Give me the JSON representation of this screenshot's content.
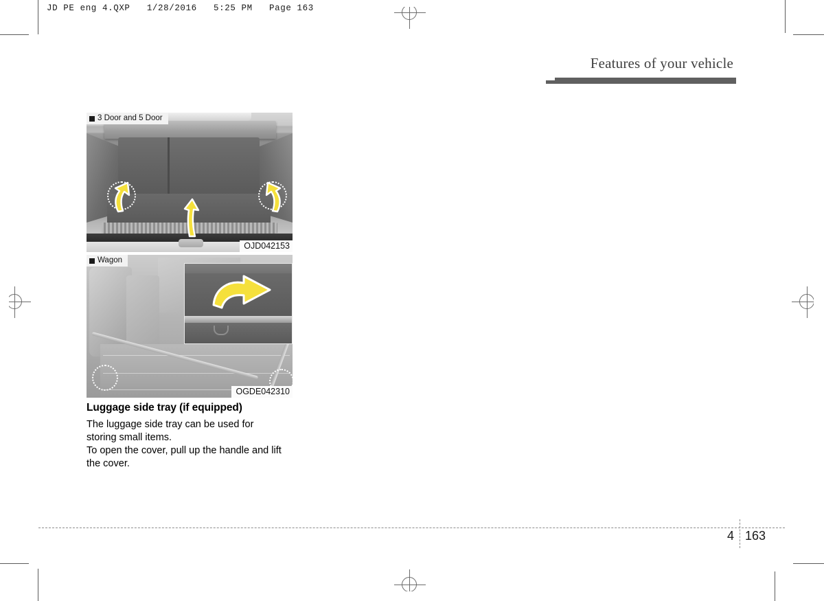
{
  "print_slug": "JD PE eng 4.QXP   1/28/2016   5:25 PM   Page 163",
  "header": {
    "chapter_title": "Features of your vehicle"
  },
  "figures": [
    {
      "label": "3 Door and 5 Door",
      "code": "OJD042153",
      "alt": "Hatchback cargo area with luggage side trays indicated by yellow arrows"
    },
    {
      "label": "Wagon",
      "code": "OGDE042310",
      "alt": "Wagon cargo area with inset detail of side tray cover handle"
    }
  ],
  "content": {
    "heading": "Luggage side tray (if equipped)",
    "paragraph_1_line_1": "The  luggage  side  tray  can  be  used  for",
    "paragraph_1_line_2": "storing small items.",
    "paragraph_2_line_1": "To open the cover, pull up the handle and",
    "paragraph_2_line_2": "lift the cover."
  },
  "footer": {
    "chapter_number": "4",
    "page_number": "163"
  },
  "colors": {
    "title_bar": "#606060",
    "arrow_fill": "#f5e03c",
    "arrow_stroke": "#ffffff",
    "text": "#000000"
  }
}
